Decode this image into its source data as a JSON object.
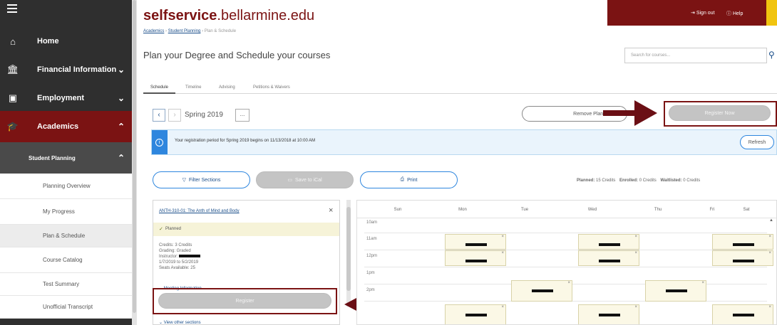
{
  "sidebar": {
    "items": [
      {
        "label": "Home",
        "icon": "home-icon"
      },
      {
        "label": "Financial Information",
        "icon": "bank-icon"
      },
      {
        "label": "Employment",
        "icon": "id-card-icon"
      },
      {
        "label": "Academics",
        "icon": "graduation-cap-icon"
      }
    ],
    "student_planning": "Student Planning",
    "subitems": [
      "Planning Overview",
      "My Progress",
      "Plan & Schedule",
      "Course Catalog",
      "Test Summary",
      "Unofficial Transcript"
    ]
  },
  "header": {
    "logo_bold": "selfservice",
    "logo_rest": ".bellarmine.edu",
    "sign_out": "Sign out",
    "help": "Help"
  },
  "breadcrumb": [
    "Academics",
    "Student Planning",
    "Plan & Schedule"
  ],
  "page": {
    "title": "Plan your Degree and Schedule your courses",
    "search_placeholder": "Search for courses..."
  },
  "tabs": [
    "Schedule",
    "Timeline",
    "Advising",
    "Petitions & Waivers"
  ],
  "term": {
    "label": "Spring 2019",
    "more": "...",
    "remove_planned": "Remove Planned",
    "register_now": "Register Now"
  },
  "notice": {
    "text": "Your registration period for Spring 2019 begins on 11/13/2018 at 10:00 AM",
    "refresh": "Refresh"
  },
  "actions": {
    "filter": "Filter Sections",
    "save": "Save to iCal",
    "print": "Print"
  },
  "credits": {
    "planned_label": "Planned:",
    "planned_value": "15 Credits",
    "enrolled_label": "Enrolled:",
    "enrolled_value": "0 Credits",
    "waitlisted_label": "Waitlisted:",
    "waitlisted_value": "0 Credits"
  },
  "course": {
    "title": "ANTH-310-01: The Anth of Mind and Body",
    "status": "Planned",
    "credits": "Credits: 3 Credits",
    "grading": "Grading: Graded",
    "instructor": "Instructor:",
    "dates": "1/7/2019 to 5/2/2019",
    "seats": "Seats Available: 25",
    "meeting": "Meeting Information",
    "register": "Register",
    "view_other": "View other sections"
  },
  "calendar": {
    "days": [
      "Sun",
      "Mon",
      "Tue",
      "Wed",
      "Thu",
      "Fri",
      "Sat"
    ],
    "times": [
      "10am",
      "11am",
      "12pm",
      "1pm",
      "2pm"
    ]
  },
  "colors": {
    "maroon": "#7b1313",
    "sidebar": "#2f2f2f",
    "planned_bg": "#fbf8e6",
    "notice_bg": "#eaf4fc",
    "help_accent": "#f1c40f"
  }
}
